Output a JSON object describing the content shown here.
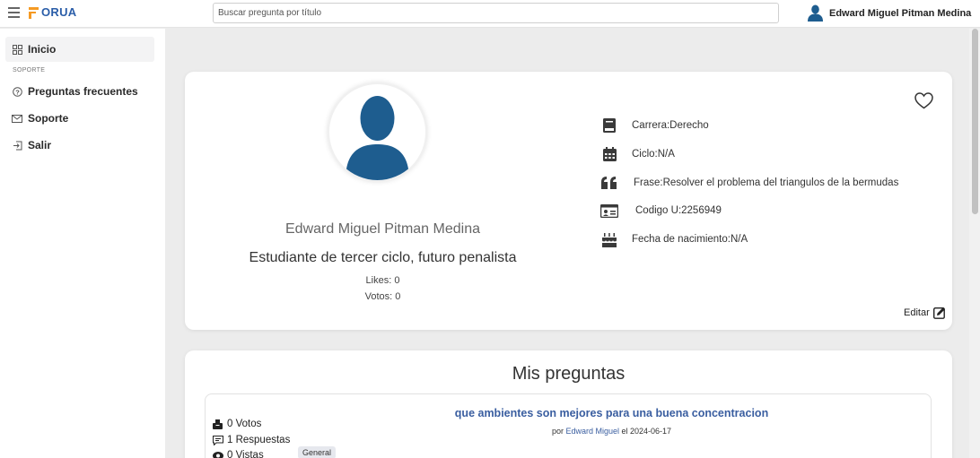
{
  "app": {
    "logo_text": "ORUA",
    "brand_color": "#2a5da8",
    "accent_color": "#f59a23"
  },
  "search": {
    "placeholder": "Buscar pregunta por título"
  },
  "user": {
    "name": "Edward Miguel Pitman Medina"
  },
  "sidebar": {
    "items": [
      {
        "label": "Inicio",
        "icon": "grid-icon",
        "active": true
      },
      {
        "label": "Preguntas frecuentes",
        "icon": "help-circle-icon"
      },
      {
        "label": "Soporte",
        "icon": "mail-icon"
      },
      {
        "label": "Salir",
        "icon": "logout-icon"
      }
    ],
    "section_label": "SOPORTE"
  },
  "profile": {
    "name": "Edward Miguel Pitman Medina",
    "description": "Estudiante de tercer ciclo, futuro penalista",
    "likes": "Likes: 0",
    "votes": "Votos: 0",
    "info": [
      {
        "text": "Carrera:Derecho",
        "icon": "book-icon"
      },
      {
        "text": "Ciclo:N/A",
        "icon": "calendar-icon"
      },
      {
        "text": "Frase:Resolver el problema del triangulos de la bermudas",
        "icon": "quote-icon"
      },
      {
        "text": "Codigo U:2256949",
        "icon": "id-card-icon"
      },
      {
        "text": "Fecha de nacimiento:N/A",
        "icon": "cake-icon"
      }
    ],
    "edit_label": "Editar"
  },
  "questions": {
    "title": "Mis preguntas",
    "items": [
      {
        "title": "que ambientes son mejores para una buena concentracion",
        "meta_prefix": "por",
        "author": "Edward Miguel",
        "meta_suffix": "el 2024-06-17",
        "votes": "0 Votos",
        "answers": "1 Respuestas",
        "views": "0 Vistas",
        "tag": "General"
      }
    ]
  }
}
